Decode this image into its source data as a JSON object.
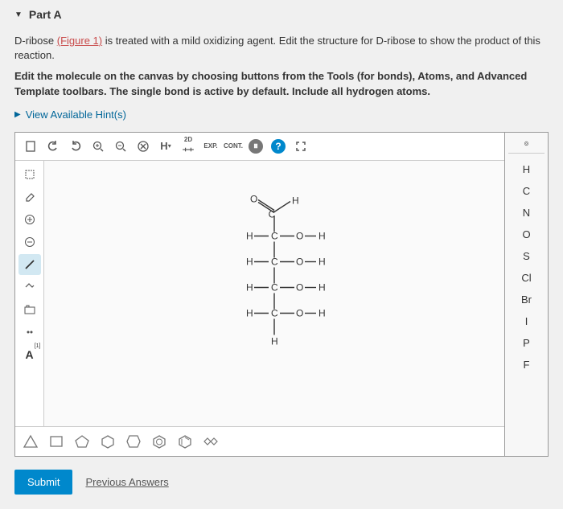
{
  "part": {
    "title": "Part A"
  },
  "instructions": {
    "line1a": "D-ribose ",
    "figure_link": "(Figure 1)",
    "line1b": " is treated with a mild oxidizing agent. Edit the structure for D-ribose to show the product of this reaction.",
    "line2": "Edit the molecule on the canvas by choosing buttons from the Tools (for bonds), Atoms, and Advanced Template toolbars. The single bond is active by default. Include all hydrogen atoms."
  },
  "hints": {
    "label": "View Available Hint(s)"
  },
  "top_toolbar": {
    "h_label": "H",
    "d2": "2D",
    "exp": "EXP.",
    "cont": "CONT."
  },
  "left_toolbar": {
    "atom": "[1]",
    "a_label": "A"
  },
  "right_panel": {
    "header": "๏",
    "elements": [
      "H",
      "C",
      "N",
      "O",
      "S",
      "Cl",
      "Br",
      "I",
      "P",
      "F"
    ]
  },
  "molecule": {
    "atoms": {
      "top_o": "O",
      "top_h": "H",
      "r1_h": "H",
      "r1_c": "C",
      "r1_o": "O",
      "r1_oh": "H",
      "r2_h": "H",
      "r2_c": "C",
      "r2_o": "O",
      "r2_oh": "H",
      "r3_h": "H",
      "r3_c": "C",
      "r3_o": "O",
      "r3_oh": "H",
      "r4_h": "H",
      "r4_c": "C",
      "r4_o": "O",
      "r4_oh": "H",
      "bot_h": "H"
    }
  },
  "actions": {
    "submit": "Submit",
    "previous": "Previous Answers"
  }
}
